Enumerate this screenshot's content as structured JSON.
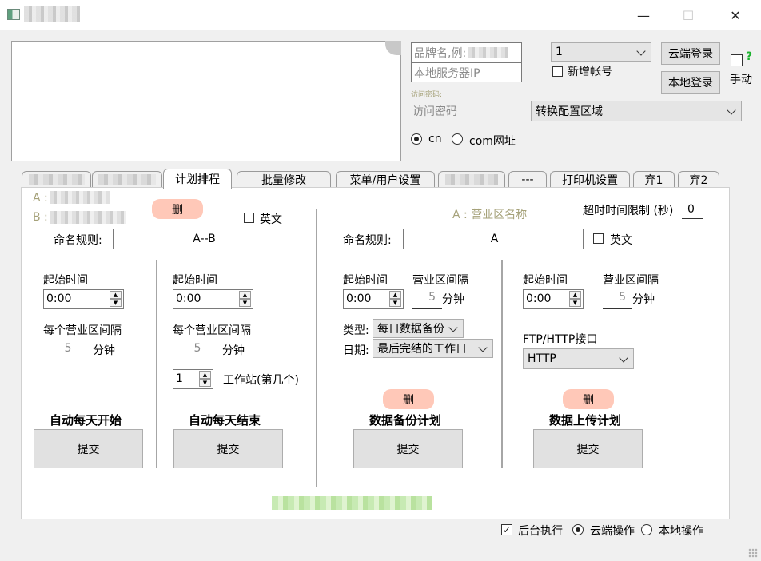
{
  "window": {
    "minimize": "—",
    "maximize": "☐",
    "close": "✕"
  },
  "top": {
    "brand_placeholder": "品牌名,例:",
    "server_placeholder": "本地服务器IP",
    "account_select": "1",
    "new_account_label": "新增帐号",
    "cloud_login": "云端登录",
    "local_login": "本地登录",
    "manual_label": "手动",
    "help_mark": "?",
    "access_pwd_caption": "访问密码:",
    "access_pwd_placeholder": "访问密码",
    "convert_select": "转换配置区域",
    "radio_cn": "cn",
    "radio_com": "com网址"
  },
  "tabs": [
    "计划排程",
    "批量修改",
    "菜单/用户设置",
    "---",
    "打印机设置",
    "弃1",
    "弃2"
  ],
  "left": {
    "a_label": "A :",
    "b_label": "B :",
    "delete": "删",
    "english": "英文",
    "naming_label": "命名规则:",
    "naming_value": "A--B",
    "start_time_1": "起始时间",
    "start_value_1": "0:00",
    "interval_label_1": "每个营业区间隔",
    "interval_value_1": "5",
    "minute_1": "分钟",
    "start_time_2": "起始时间",
    "start_value_2": "0:00",
    "interval_label_2": "每个营业区间隔",
    "interval_value_2": "5",
    "minute_2": "分钟",
    "station_value": "1",
    "station_label": "工作站(第几个)",
    "auto_start": "自动每天开始",
    "auto_end": "自动每天结束",
    "submit": "提交"
  },
  "right": {
    "area_name": "A : 营业区名称",
    "timeout_label": "超时时间限制 (秒)",
    "timeout_value": "0",
    "naming_label": "命名规则:",
    "naming_value": "A",
    "english": "英文",
    "backup": {
      "start_label": "起始时间",
      "start_value": "0:00",
      "interval_label": "营业区间隔",
      "interval_value": "5",
      "minute": "分钟",
      "type_label": "类型:",
      "type_value": "每日数据备份",
      "date_label": "日期:",
      "date_value": "最后完结的工作日",
      "delete": "删",
      "title": "数据备份计划",
      "submit": "提交"
    },
    "upload": {
      "start_label": "起始时间",
      "start_value": "0:00",
      "interval_label": "营业区间隔",
      "interval_value": "5",
      "minute": "分钟",
      "ftp_label": "FTP/HTTP接口",
      "ftp_value": "HTTP",
      "delete": "删",
      "title": "数据上传计划",
      "submit": "提交"
    }
  },
  "bottom": {
    "background_exec": "后台执行",
    "cloud_op": "云端操作",
    "local_op": "本地操作"
  }
}
